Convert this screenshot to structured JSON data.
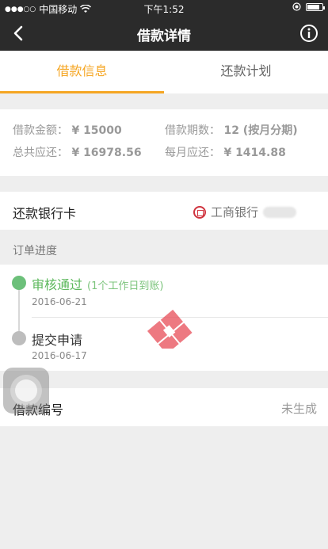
{
  "status_bar": {
    "carrier": "中国移动",
    "time": "下午1:52",
    "battery_level": 0.85
  },
  "nav": {
    "title": "借款详情",
    "back_icon": "chevron-left-icon",
    "info_icon": "info-circle-icon"
  },
  "tabs": [
    {
      "label": "借款信息",
      "active": true
    },
    {
      "label": "还款计划",
      "active": false
    }
  ],
  "loan_info": {
    "amount_label": "借款金额：",
    "amount_value": "¥ 15000",
    "term_label": "借款期数：",
    "term_value": "12 (按月分期)",
    "total_label": "总共应还：",
    "total_value": "¥ 16978.56",
    "monthly_label": "每月应还：",
    "monthly_value": "¥ 1414.88"
  },
  "bank": {
    "label": "还款银行卡",
    "bank_name": "工商银行"
  },
  "progress": {
    "section_title": "订单进度",
    "steps": [
      {
        "title": "审核通过",
        "note": "(1个工作日到账)",
        "date": "2016-06-21",
        "status_color": "#6cc07a"
      },
      {
        "title": "提交申请",
        "date": "2016-06-17",
        "status_color": "#bdbdbd"
      }
    ]
  },
  "loan_number": {
    "label": "借款编号",
    "value": "未生成"
  },
  "colors": {
    "accent": "#f5a623",
    "header_bg": "#2b2b2b",
    "success": "#6cc07a"
  }
}
